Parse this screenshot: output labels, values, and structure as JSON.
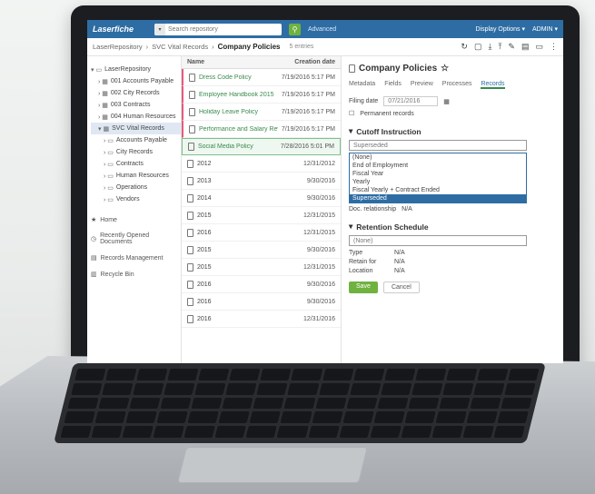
{
  "app": {
    "logo": "Laserfiche"
  },
  "topbar": {
    "search_placeholder": "Search repository",
    "advanced": "Advanced",
    "display_options": "Display Options ▾",
    "admin": "ADMIN ▾"
  },
  "breadcrumb": {
    "items": [
      "LaserRepository",
      "›",
      "SVC Vital Records",
      "›"
    ],
    "current": "Company Policies",
    "entries": "5 entries"
  },
  "tree": {
    "nodes": [
      "LaserRepository",
      "001 Accounts Payable",
      "002 City Records",
      "003 Contracts",
      "004 Human Resources",
      "SVC Vital Records",
      "Accounts Payable",
      "City Records",
      "Contracts",
      "Human Resources",
      "Operations",
      "Vendors"
    ],
    "nav": [
      "Home",
      "Recently Opened Documents",
      "Records Management",
      "Recycle Bin"
    ]
  },
  "list": {
    "col_name": "Name",
    "col_date": "Creation date",
    "rows": [
      {
        "name": "Dress Code Policy",
        "date": "7/19/2016 5:17 PM"
      },
      {
        "name": "Employee Handbook 2015",
        "date": "7/19/2016 5:17 PM"
      },
      {
        "name": "Holiday Leave Policy",
        "date": "7/19/2016 5:17 PM"
      },
      {
        "name": "Performance and Salary Revie...",
        "date": "7/19/2016 5:17 PM"
      },
      {
        "name": "Social Media Policy",
        "date": "7/28/2016 5:01 PM"
      },
      {
        "name": "2012",
        "date": "12/31/2012"
      },
      {
        "name": "2013",
        "date": "9/30/2016"
      },
      {
        "name": "2014",
        "date": "9/30/2016"
      },
      {
        "name": "2015",
        "date": "12/31/2015"
      },
      {
        "name": "2016",
        "date": "12/31/2015"
      },
      {
        "name": "2015",
        "date": "9/30/2016"
      },
      {
        "name": "2015",
        "date": "12/31/2015"
      },
      {
        "name": "2016",
        "date": "9/30/2016"
      },
      {
        "name": "2016",
        "date": "9/30/2016"
      },
      {
        "name": "2016",
        "date": "12/31/2016"
      }
    ]
  },
  "panel": {
    "title": "Company Policies",
    "tabs": [
      "Metadata",
      "Fields",
      "Preview",
      "Processes",
      "Records"
    ],
    "filing_label": "Filing date",
    "filing_value": "07/21/2016",
    "permanent": "Permanent records",
    "cutoff_heading": "Cutoff Instruction",
    "cutoff_selected": "Superseded",
    "cutoff_options": [
      "(None)",
      "End of Employment",
      "Fiscal Year",
      "Yearly",
      "Fiscal Yearly + Contract Ended",
      "Superseded"
    ],
    "doc_rel_label": "Doc. relationship",
    "doc_rel_value": "N/A",
    "retention_heading": "Retention Schedule",
    "retention_selected": "(None)",
    "type_label": "Type",
    "type_value": "N/A",
    "retain_label": "Retain for",
    "retain_value": "N/A",
    "location_label": "Location",
    "location_value": "N/A",
    "save": "Save",
    "cancel": "Cancel"
  }
}
